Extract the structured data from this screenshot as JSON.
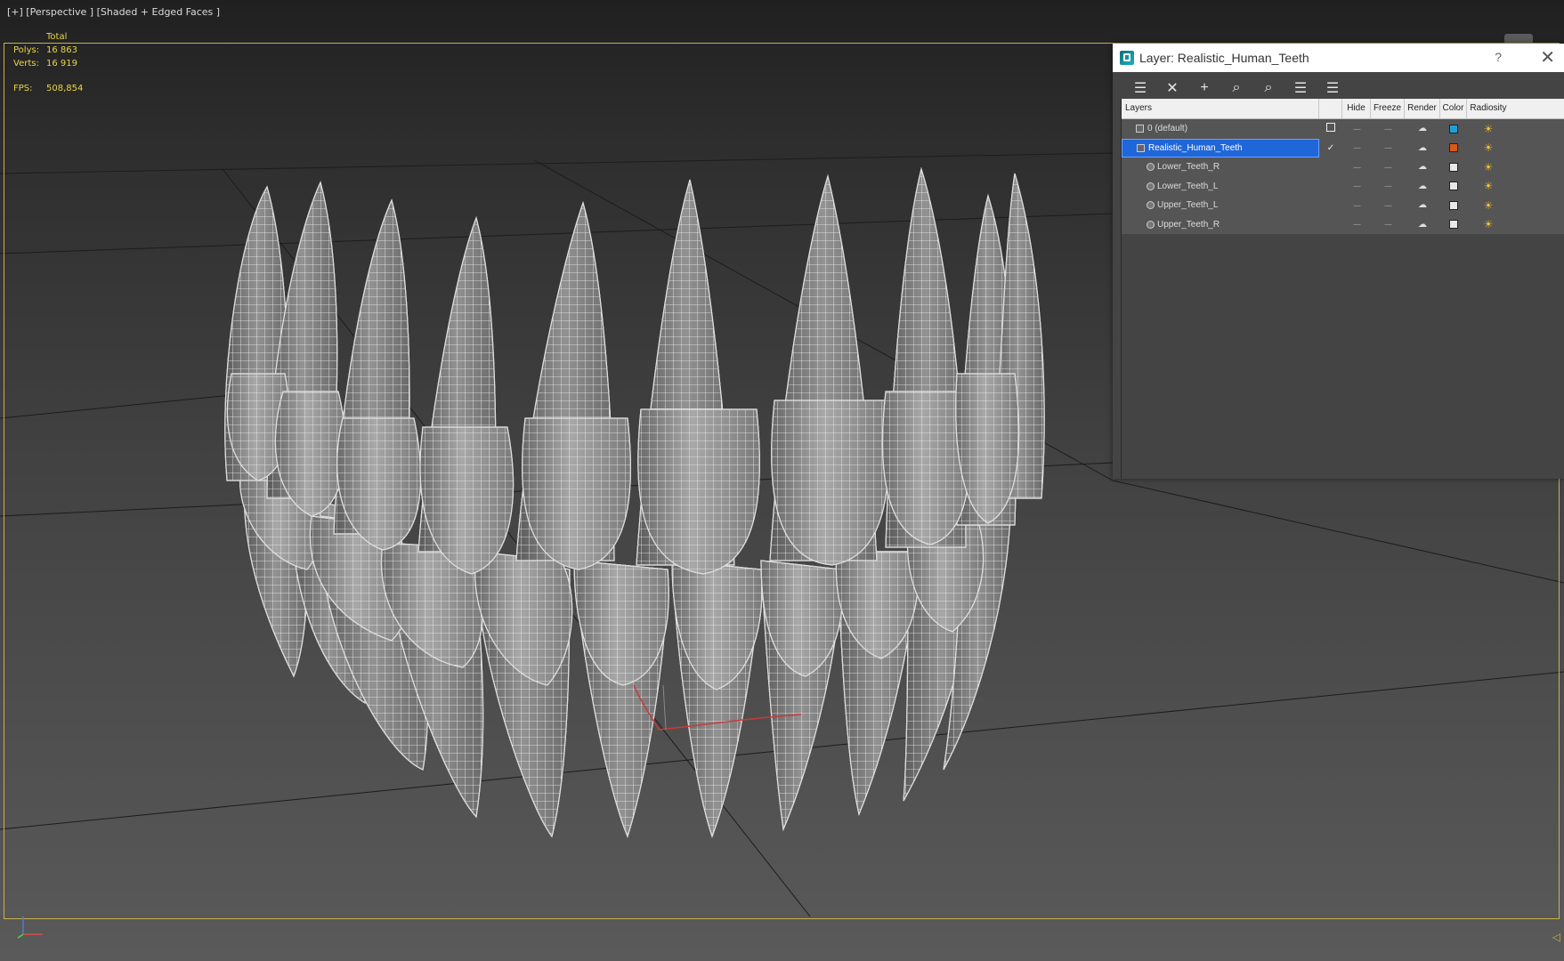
{
  "viewport": {
    "label": "[+] [Perspective ] [Shaded + Edged Faces ]",
    "stats": {
      "header": "Total",
      "polys_label": "Polys:",
      "polys_value": "16 863",
      "verts_label": "Verts:",
      "verts_value": "16 919",
      "fps_label": "FPS:",
      "fps_value": "508,854"
    },
    "frame_color": "#c8b14a"
  },
  "dialog": {
    "title": "Layer: Realistic_Human_Teeth",
    "help": "?",
    "close": "✕",
    "toolbar": [
      {
        "name": "create-layer-icon",
        "glyph": "☰"
      },
      {
        "name": "delete-layer-icon",
        "glyph": "✕"
      },
      {
        "name": "add-to-layer-icon",
        "glyph": "+"
      },
      {
        "name": "select-objects-icon",
        "glyph": "⌕"
      },
      {
        "name": "highlight-layer-icon",
        "glyph": "⌕"
      },
      {
        "name": "hide-all-icon",
        "glyph": "☰"
      },
      {
        "name": "freeze-all-icon",
        "glyph": "☰"
      }
    ],
    "columns": {
      "layers": "Layers",
      "hide": "Hide",
      "freeze": "Freeze",
      "render": "Render",
      "color": "Color",
      "radiosity": "Radiosity"
    },
    "rows": [
      {
        "name": "0 (default)",
        "color": "#1e9fd8",
        "selected": false,
        "level": 1,
        "current": "box"
      },
      {
        "name": "Realistic_Human_Teeth",
        "color": "#d85a14",
        "selected": true,
        "level": 1,
        "current": "check"
      },
      {
        "name": "Lower_Teeth_R",
        "color": "#e8e8e8",
        "selected": false,
        "level": 2,
        "current": ""
      },
      {
        "name": "Lower_Teeth_L",
        "color": "#e8e8e8",
        "selected": false,
        "level": 2,
        "current": ""
      },
      {
        "name": "Upper_Teeth_L",
        "color": "#e8e8e8",
        "selected": false,
        "level": 2,
        "current": ""
      },
      {
        "name": "Upper_Teeth_R",
        "color": "#e8e8e8",
        "selected": false,
        "level": 2,
        "current": ""
      }
    ],
    "hide_glyph": "----",
    "freeze_glyph": "----",
    "render_glyph": "☁",
    "radiosity_glyph": "☀"
  }
}
